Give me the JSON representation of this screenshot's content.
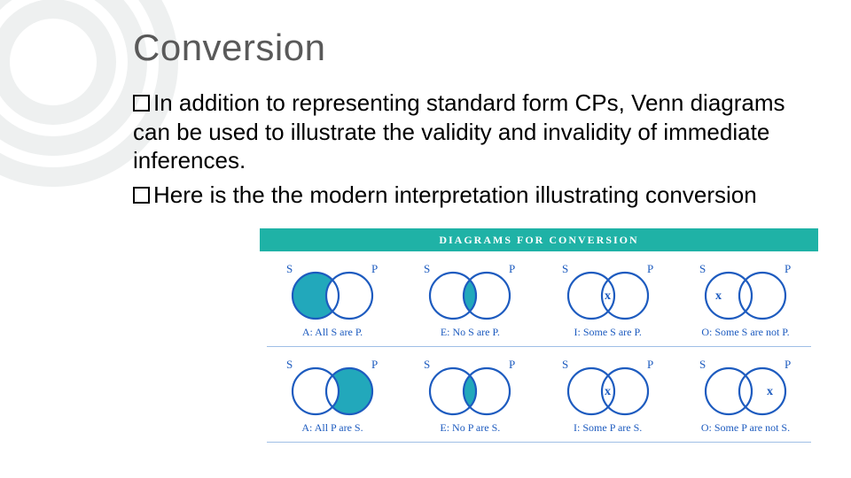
{
  "title": "Conversion",
  "bullets": [
    "In addition to representing standard form CPs, Venn diagrams can be used to illustrate the validity and invalidity of immediate inferences.",
    "Here is the the modern interpretation illustrating conversion"
  ],
  "diagram": {
    "banner": "DIAGRAMS FOR CONVERSION",
    "S": "S",
    "P": "P",
    "row1": [
      {
        "caption": "A: All S are P."
      },
      {
        "caption": "E: No S are P."
      },
      {
        "caption": "I: Some S are P."
      },
      {
        "caption": "O: Some S are not P."
      }
    ],
    "row2": [
      {
        "caption": "A: All P are S."
      },
      {
        "caption": "E: No P are S."
      },
      {
        "caption": "I: Some P are S."
      },
      {
        "caption": "O: Some P are not S."
      }
    ]
  }
}
